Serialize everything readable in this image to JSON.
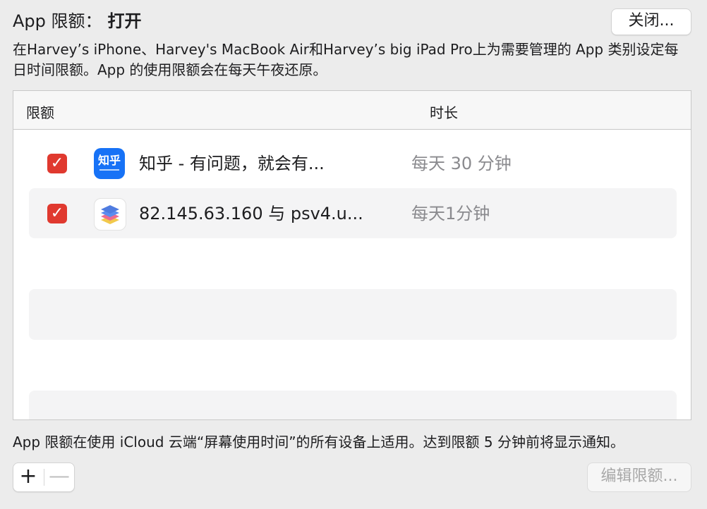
{
  "status": {
    "label": "App 限额：",
    "value": "打开"
  },
  "close_button_label": "关闭...",
  "description": "在Harvey’s iPhone、Harvey's MacBook Air和Harvey’s big iPad Pro上为需要管理的 App 类别设定每日时间限额。App 的使用限额会在每天午夜还原。",
  "table": {
    "headers": {
      "limit": "限额",
      "duration": "时长"
    },
    "rows": [
      {
        "checked": true,
        "checkmark": "✓",
        "icon": "zhihu-app-icon",
        "icon_text": "知乎",
        "name": "知乎 - 有问题，就会有...",
        "duration": "每天 30 分钟"
      },
      {
        "checked": true,
        "checkmark": "✓",
        "icon": "stacked-layers-app-icon",
        "name": "82.145.63.160 与 psv4.u...",
        "duration": "每天1分钟"
      }
    ]
  },
  "footnote": "App 限额在使用 iCloud 云端“屏幕使用时间”的所有设备上适用。达到限额 5 分钟前将显示通知。",
  "controls": {
    "add_label": "+",
    "remove_label": "—",
    "edit_button_label": "编辑限额..."
  },
  "colors": {
    "checkbox": "#e0392f",
    "zhihu_blue": "#1772f6",
    "duration_text": "#8a8a8e"
  }
}
